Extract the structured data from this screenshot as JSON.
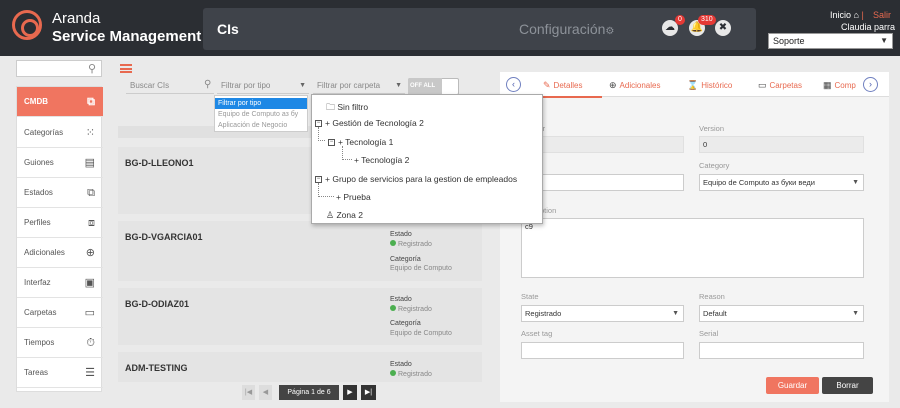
{
  "header": {
    "brand_line1": "Aranda",
    "brand_line2": "Service Management",
    "module_title": "CIs",
    "configuracion": "Configuración",
    "gear_icon": "gear-icon",
    "cloud_badge": "0",
    "bell_badge": "310",
    "inicio": "Inicio",
    "home_icon": "home-icon",
    "separator": "|",
    "salir": "Salir",
    "user": "Claudia parra",
    "role": "Soporte"
  },
  "sidebar": {
    "search_placeholder": "",
    "items": [
      {
        "label": "CMDB",
        "icon": "layers-icon"
      },
      {
        "label": "Categorías",
        "icon": "grid-icon"
      },
      {
        "label": "Guiones",
        "icon": "script-icon"
      },
      {
        "label": "Estados",
        "icon": "states-icon"
      },
      {
        "label": "Perfiles",
        "icon": "profile-icon"
      },
      {
        "label": "Adicionales",
        "icon": "plus-circle-icon"
      },
      {
        "label": "Interfaz",
        "icon": "monitor-icon"
      },
      {
        "label": "Carpetas",
        "icon": "folder-icon"
      },
      {
        "label": "Tiempos",
        "icon": "timer-icon"
      },
      {
        "label": "Tareas",
        "icon": "tasks-icon"
      }
    ]
  },
  "filters": {
    "search_placeholder": "Buscar CIs",
    "tipo_placeholder": "Filtrar por tipo",
    "carpeta_placeholder": "Filtrar por carpeta",
    "toggle_off": "OFF",
    "toggle_all": "ALL",
    "tipo_options": [
      "Filtrar por tipo",
      "Equipo de Computo аз бу",
      "Aplicación de Negocio"
    ]
  },
  "tree": {
    "items": [
      {
        "label": "Sin filtro"
      },
      {
        "label": "Gestión de Tecnología 2"
      },
      {
        "label": "Tecnología 1"
      },
      {
        "label": "Tecnología 2"
      },
      {
        "label": "Grupo de servicios para la gestion de empleados"
      },
      {
        "label": "Prueba"
      },
      {
        "label": "Zona 2"
      }
    ]
  },
  "cards": [
    {
      "name": "BG-D-LLEONO1"
    },
    {
      "name": "BG-D-VGARCIA01",
      "estado_label": "Estado",
      "estado": "Registrado",
      "categoria_label": "Categoría",
      "categoria": "Equipo de Computo"
    },
    {
      "name": "BG-D-ODIAZ01",
      "estado_label": "Estado",
      "estado": "Registrado",
      "categoria_label": "Categoría",
      "categoria": "Equipo de Computo"
    },
    {
      "name": "ADM-TESTING",
      "estado_label": "Estado",
      "estado": "Registrado"
    }
  ],
  "pagination": {
    "label": "Página 1 de 6"
  },
  "tabs": [
    {
      "label": "Detalles",
      "icon": "edit-icon"
    },
    {
      "label": "Adicionales",
      "icon": "plus-circle-icon"
    },
    {
      "label": "Histórico",
      "icon": "hourglass-icon"
    },
    {
      "label": "Carpetas",
      "icon": "folder-icon"
    },
    {
      "label": "Comp",
      "icon": "components-icon"
    }
  ],
  "form": {
    "identificador_label": "ificador",
    "identificador": "",
    "version_label": "Version",
    "version": "0",
    "category_label": "Category",
    "category": "Equipo de Computo аз буки веди",
    "description_label": "ption",
    "description": "c9",
    "state_label": "State",
    "state": "Registrado",
    "reason_label": "Reason",
    "reason": "Default",
    "asset_tag_label": "Asset tag",
    "asset_tag": "",
    "serial_label": "Serial",
    "serial": ""
  },
  "buttons": {
    "guardar": "Guardar",
    "borrar": "Borrar"
  },
  "colors": {
    "accent": "#f07560",
    "header_bg": "#2b2e33",
    "selection": "#1e88e5",
    "status_ok": "#4caf50"
  }
}
